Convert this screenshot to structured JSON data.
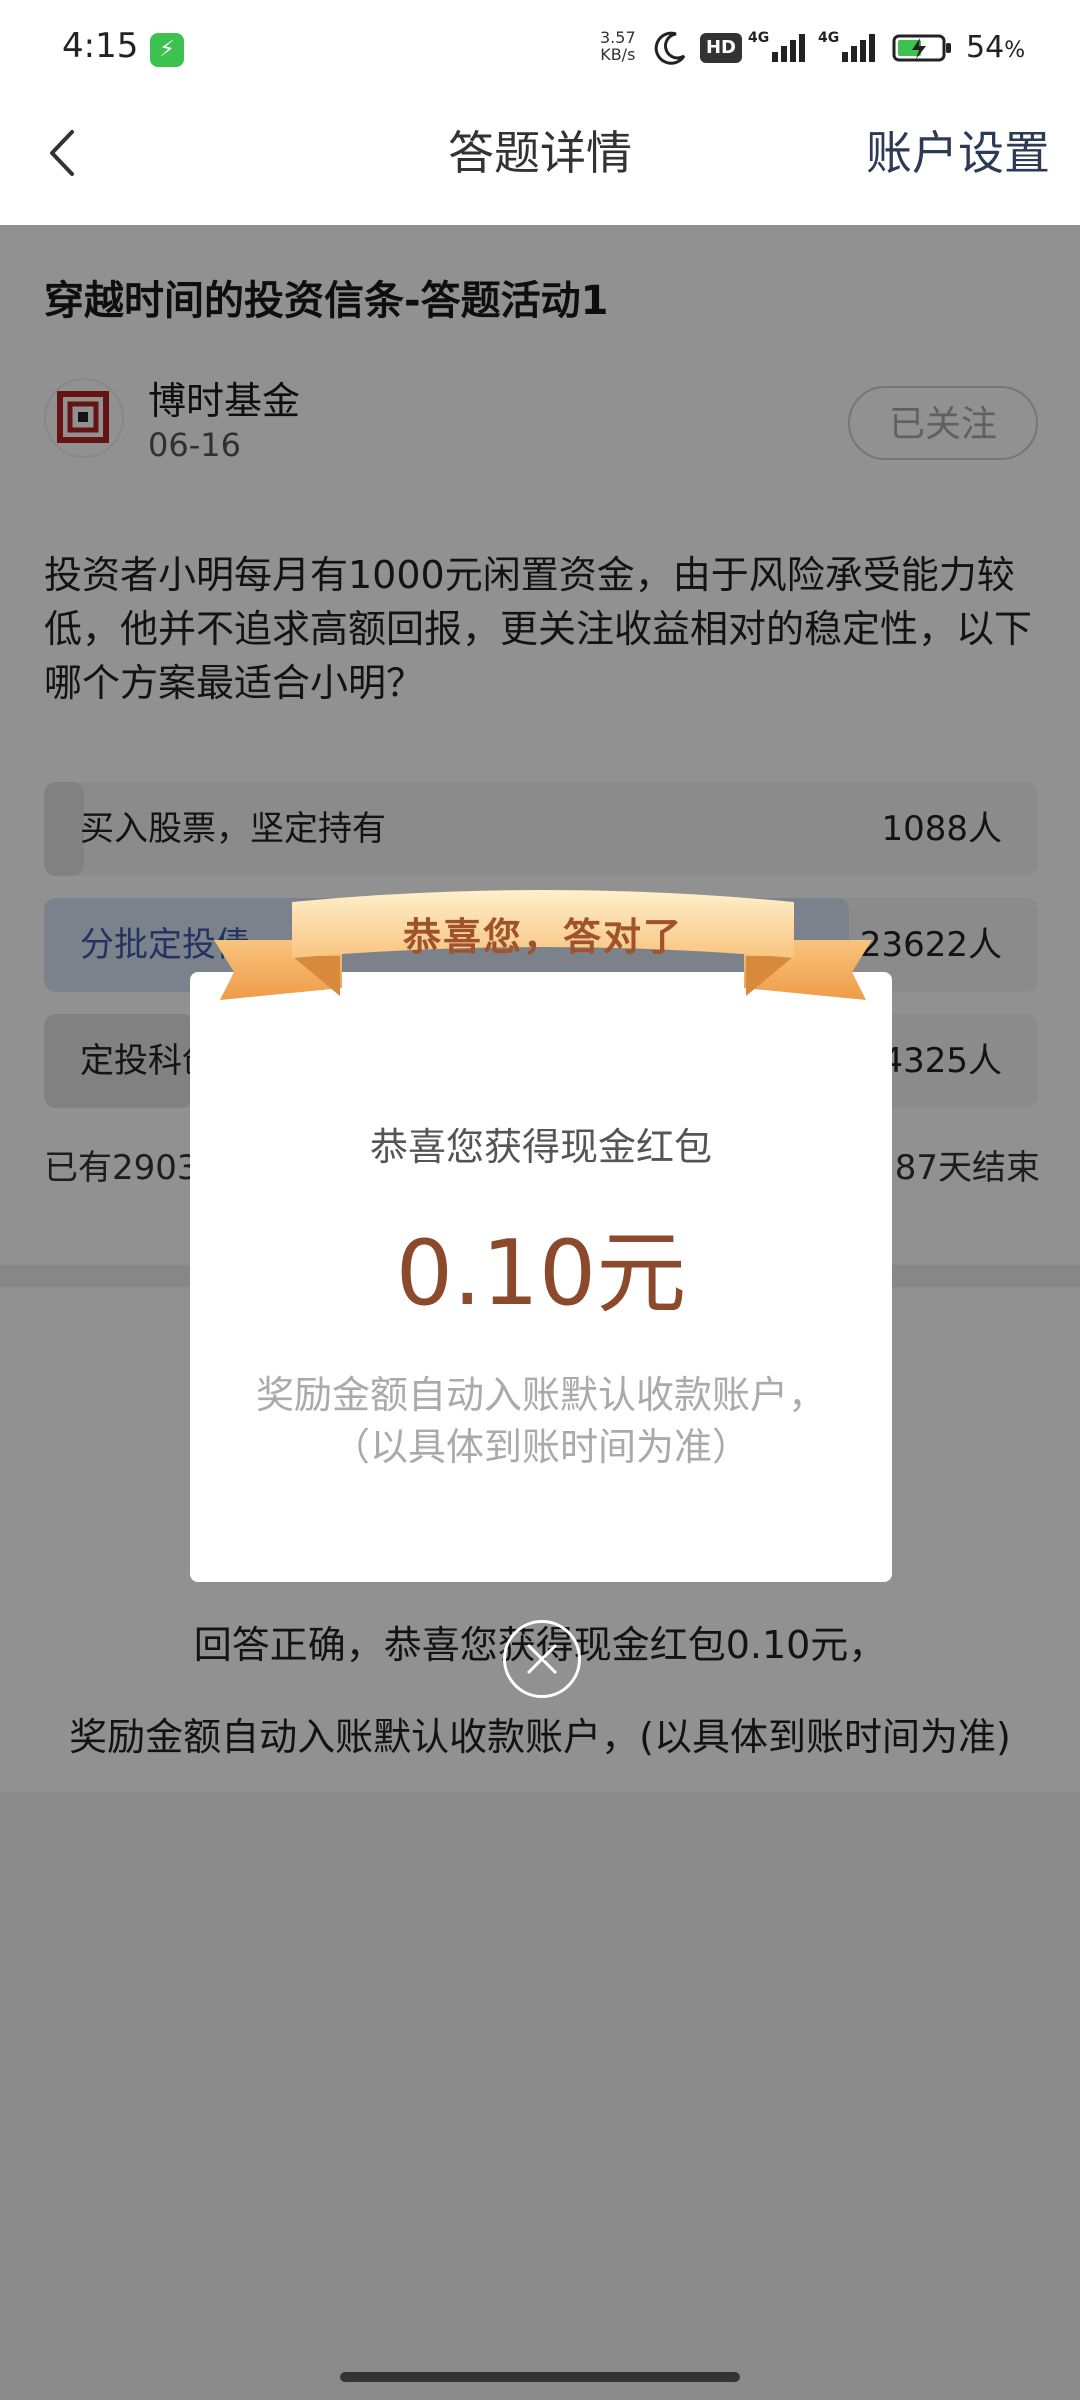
{
  "status_bar": {
    "time": "4:15",
    "net_speed_value": "3.57",
    "net_speed_unit": "KB/s",
    "hd_label": "HD",
    "signal1_label": "4G",
    "signal2_label": "4G",
    "battery_percent": "54",
    "battery_suffix": "%",
    "battery_level": 0.54
  },
  "header": {
    "title": "答题详情",
    "right_action": "账户设置"
  },
  "activity": {
    "title": "穿越时间的投资信条-答题活动1",
    "fund_name": "博时基金",
    "date": "06-16",
    "follow_label": "已关注",
    "question": "投资者小明每月有1000元闲置资金，由于风险承受能力较低，他并不追求高额回报，更关注收益相对的稳定性，以下哪个方案最适合小明？",
    "options": [
      {
        "label": "买入股票，坚定持有",
        "count": "1088人",
        "share": 0.04,
        "selected": false
      },
      {
        "label": "分批定投债",
        "count": "23622人",
        "share": 0.81,
        "selected": true
      },
      {
        "label": "定投科创",
        "count": "4325人",
        "share": 0.15,
        "selected": false
      }
    ],
    "participants": "已有2903",
    "ends": "87天结束"
  },
  "result": {
    "line1": "回答正确，恭喜您获得现金红包0.10元，",
    "line2": "奖励金额自动入账默认收款账户，(以具体到账时间为准)"
  },
  "modal": {
    "ribbon_text": "恭喜您，答对了",
    "subtitle": "恭喜您获得现金红包",
    "amount": "0.10元",
    "note_line1": "奖励金额自动入账默认收款账户，",
    "note_line2": "（以具体到账时间为准）"
  },
  "colors": {
    "option_selected_fill": "#dbe4f7",
    "option_selected_text": "#3a5ba8",
    "option_fill": "#e3e3e3",
    "ribbon_light": "#fde4b4",
    "ribbon_dark": "#f2a857",
    "amount_color": "#8b4a2b",
    "overlay": "rgba(0,0,0,0.43)"
  },
  "icons": {
    "status_bolt": "lightning-icon",
    "status_moon": "moon-icon",
    "back": "chevron-left-icon",
    "close": "close-circle-icon",
    "avatar": "fund-logo-icon"
  }
}
